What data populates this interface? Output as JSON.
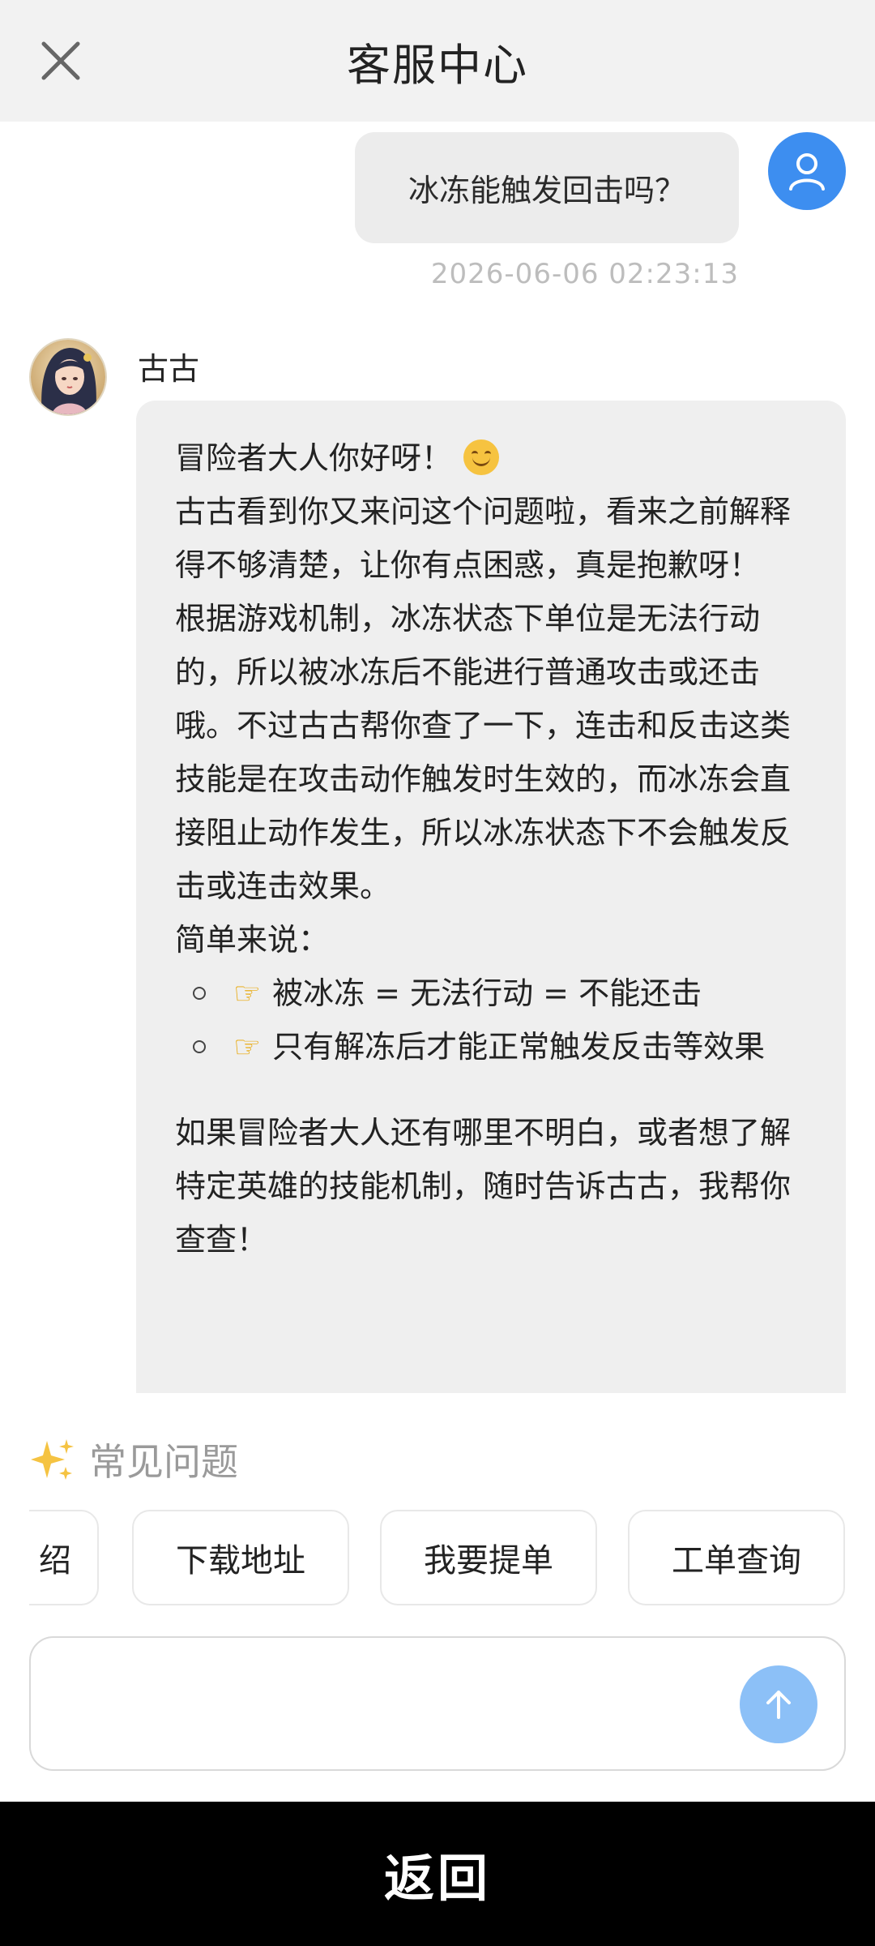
{
  "header": {
    "title": "客服中心",
    "close_icon": "close-icon"
  },
  "user_message": {
    "text": "冰冻能触发回击吗？",
    "timestamp": "2026-06-06 02:23:13",
    "avatar_icon": "user-icon",
    "avatar_color": "#3d8ef0"
  },
  "bot_message": {
    "name": "古古",
    "avatar_icon": "character-avatar",
    "greeting": "冒险者大人你好呀！",
    "greeting_emoji": "smile-emoji",
    "paragraphs": [
      "古古看到你又来问这个问题啦，看来之前解释得不够清楚，让你有点困惑，真是抱歉呀！",
      "根据游戏机制，冰冻状态下单位是无法行动的，所以被冰冻后不能进行普通攻击或还击哦。不过古古帮你查了一下，连击和反击这类技能是在攻击动作触发时生效的，而冰冻会直接阻止动作发生，所以冰冻状态下不会触发反击或连击效果。",
      "简单来说："
    ],
    "bullets": [
      "被冰冻 = 无法行动 = 不能还击",
      "只有解冻后才能正常触发反击等效果"
    ],
    "bullet_emoji": "pointing-hand-emoji",
    "closing": "如果冒险者大人还有哪里不明白，或者想了解特定英雄的技能机制，随时告诉古古，我帮你查查！"
  },
  "faq": {
    "title": "常见问题",
    "icon": "sparkles-icon",
    "chips": [
      "绍",
      "下载地址",
      "我要提单",
      "工单查询"
    ]
  },
  "input": {
    "value": "",
    "send_icon": "arrow-up-icon",
    "send_color": "#8cc0f7"
  },
  "bottom_bar": {
    "label": "返回"
  }
}
